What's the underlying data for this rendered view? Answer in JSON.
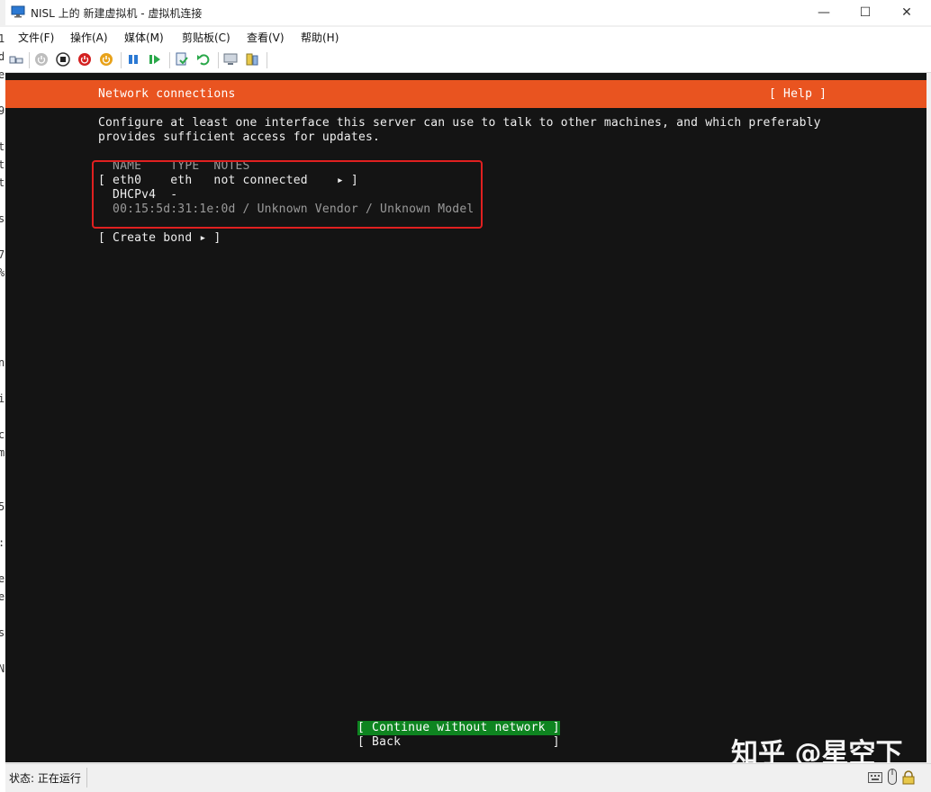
{
  "window": {
    "title": "NISL 上的 新建虚拟机 - 虚拟机连接",
    "minimize_glyph": "—",
    "maximize_glyph": "☐",
    "close_glyph": "✕"
  },
  "menu": {
    "items": [
      "文件(F)",
      "操作(A)",
      "媒体(M)",
      "剪贴板(C)",
      "查看(V)",
      "帮助(H)"
    ]
  },
  "toolbar": {
    "icons": [
      "ctrl-alt-del-icon",
      "start-icon",
      "stop-icon",
      "shutdown-icon",
      "power-icon",
      "pause-icon",
      "resume-icon",
      "checkpoint-icon",
      "revert-icon",
      "enhanced-session-icon",
      "share-icon"
    ]
  },
  "terminal": {
    "header_title": "Network connections",
    "help_button": "[ Help ]",
    "description_line1": "Configure at least one interface this server can use to talk to other machines, and which preferably",
    "description_line2": "provides sufficient access for updates.",
    "table_header": "  NAME    TYPE  NOTES",
    "row_eth0": "[ eth0    eth   not connected    ▸ ]",
    "row_dhcp": "  DHCPv4  -",
    "row_mac": "  00:15:5d:31:1e:0d / Unknown Vendor / Unknown Model",
    "create_bond": "[ Create bond ▸ ]",
    "continue_button": "[ Continue without network ]",
    "back_button": "[ Back                     ]"
  },
  "status": {
    "label": "状态: 正在运行"
  },
  "watermark": "知乎 @星空下",
  "left_strip_chars": [
    "1",
    "d",
    "e",
    "9",
    "t",
    "t",
    "t",
    "s",
    "7",
    "%",
    "n",
    "i",
    "c",
    "m",
    "5",
    ":",
    "e",
    "e",
    "s",
    "N"
  ],
  "colors": {
    "ubuntu_orange": "#e95420",
    "continue_green": "#0e8420",
    "highlight_red": "#e02020"
  }
}
